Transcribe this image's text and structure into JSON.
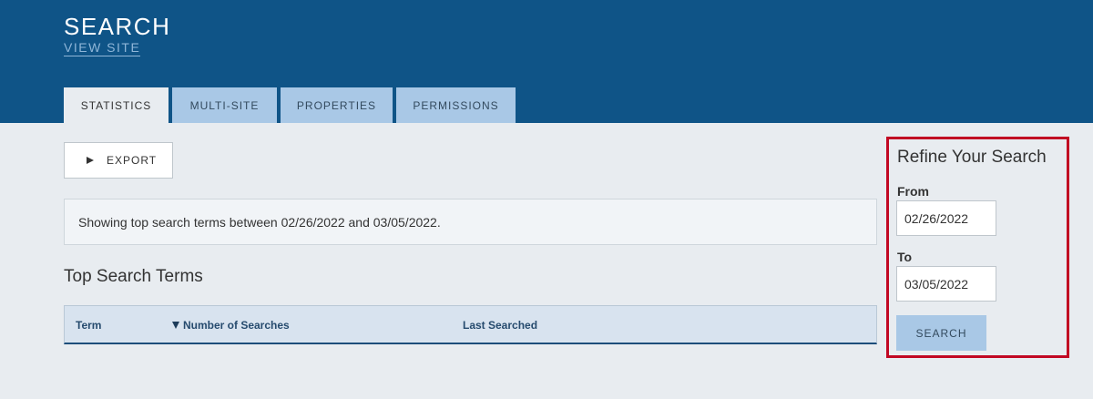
{
  "header": {
    "title": "SEARCH",
    "view_site_label": "VIEW SITE"
  },
  "tabs": [
    {
      "label": "STATISTICS",
      "active": true
    },
    {
      "label": "MULTI-SITE",
      "active": false
    },
    {
      "label": "PROPERTIES",
      "active": false
    },
    {
      "label": "PERMISSIONS",
      "active": false
    }
  ],
  "toolbar": {
    "export_label": "EXPORT",
    "export_icon": "play-icon"
  },
  "info": {
    "message": "Showing top search terms between 02/26/2022 and 03/05/2022."
  },
  "top_terms": {
    "title": "Top Search Terms",
    "columns": [
      {
        "label": "Term"
      },
      {
        "label": "Number of Searches",
        "sorted": "descending"
      },
      {
        "label": "Last Searched"
      }
    ],
    "rows": []
  },
  "refine": {
    "title": "Refine Your Search",
    "from_label": "From",
    "from_value": "02/26/2022",
    "to_label": "To",
    "to_value": "03/05/2022",
    "search_label": "SEARCH",
    "highlight_color": "#c10823"
  },
  "colors": {
    "header_bg": "#0f5487",
    "tab_bg": "#a9c8e6",
    "page_bg": "#e8ecf0"
  }
}
